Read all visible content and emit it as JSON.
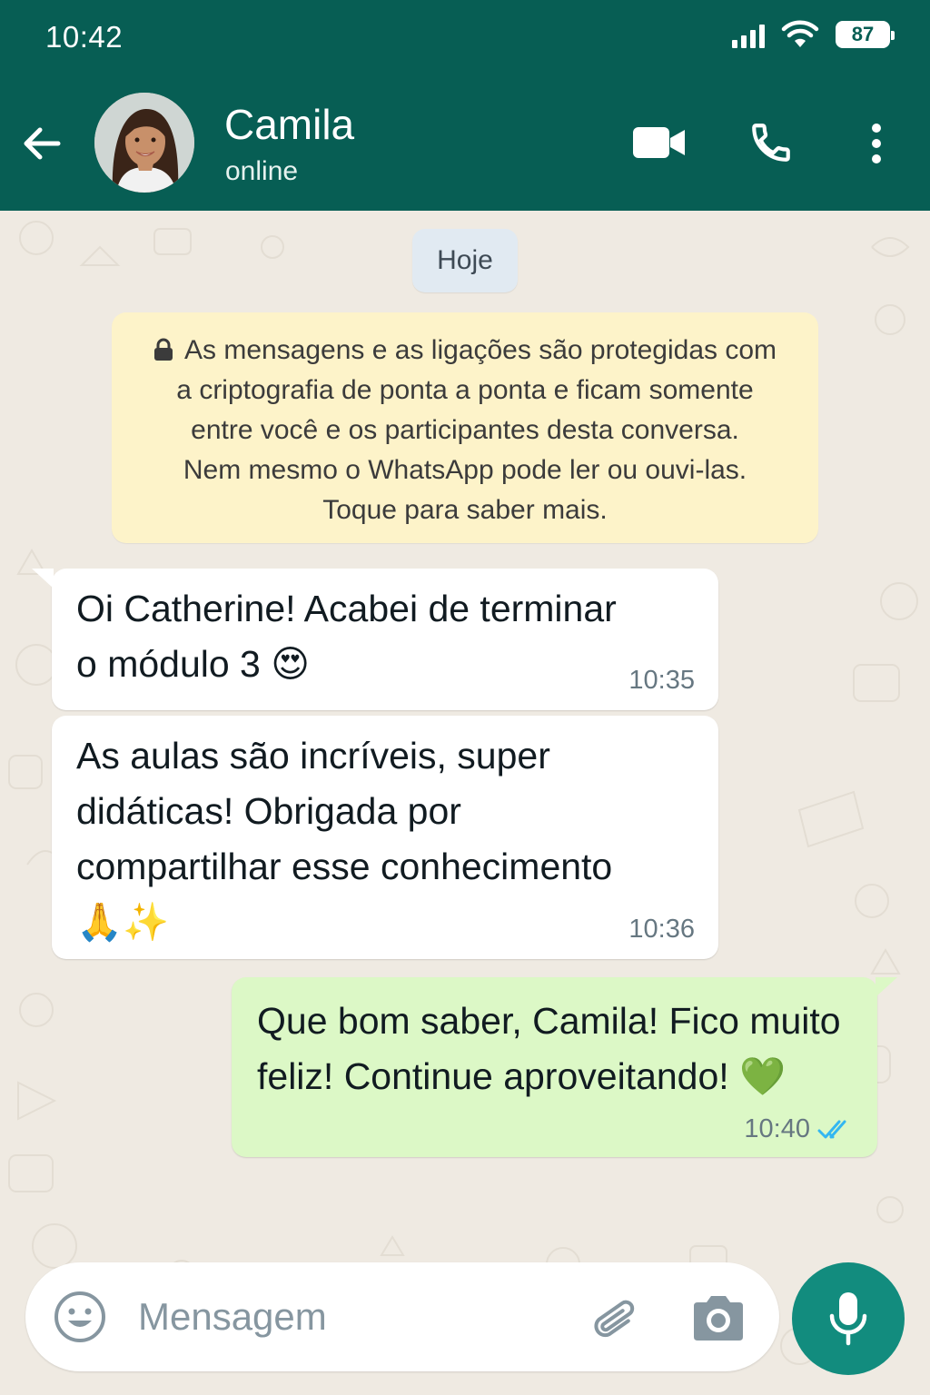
{
  "status_bar": {
    "time": "10:42",
    "battery": "87"
  },
  "header": {
    "contact_name": "Camila",
    "contact_status": "online",
    "icons": [
      "back-arrow-icon",
      "video-call-icon",
      "phone-icon",
      "more-vert-icon"
    ]
  },
  "chat": {
    "date_chip": "Hoje",
    "encryption_notice": {
      "lines": [
        "As mensagens e as ligações são protegidas com",
        "a criptografia de ponta a ponta e ficam somente",
        "entre você e os participantes desta conversa.",
        "Nem mesmo o WhatsApp pode ler ou ouvi-las.",
        "Toque para saber mais."
      ]
    },
    "messages": [
      {
        "direction": "incoming",
        "lines": [
          "Oi Catherine! Acabei de terminar",
          "o módulo 3 😍"
        ],
        "time": "10:35"
      },
      {
        "direction": "incoming",
        "lines": [
          "As aulas são incríveis, super",
          "didáticas! Obrigada por",
          "compartilhar esse conhecimento",
          "🙏✨"
        ],
        "time": "10:36"
      },
      {
        "direction": "outgoing",
        "lines": [
          "Que bom saber, Camila! Fico muito",
          "feliz! Continue aproveitando! 💚"
        ],
        "time": "10:40",
        "status": "read"
      }
    ]
  },
  "composer": {
    "placeholder": "Mensagem",
    "icons": [
      "emoji-icon",
      "attach-icon",
      "camera-icon",
      "mic-icon"
    ]
  },
  "colors": {
    "header": "#075e54",
    "chat_background": "#efeae2",
    "outgoing_bubble": "#dcf8c6",
    "incoming_bubble": "#ffffff",
    "notice_background": "#fdf3c9",
    "mic_button": "#128c7e",
    "read_receipt": "#34b7f1"
  }
}
